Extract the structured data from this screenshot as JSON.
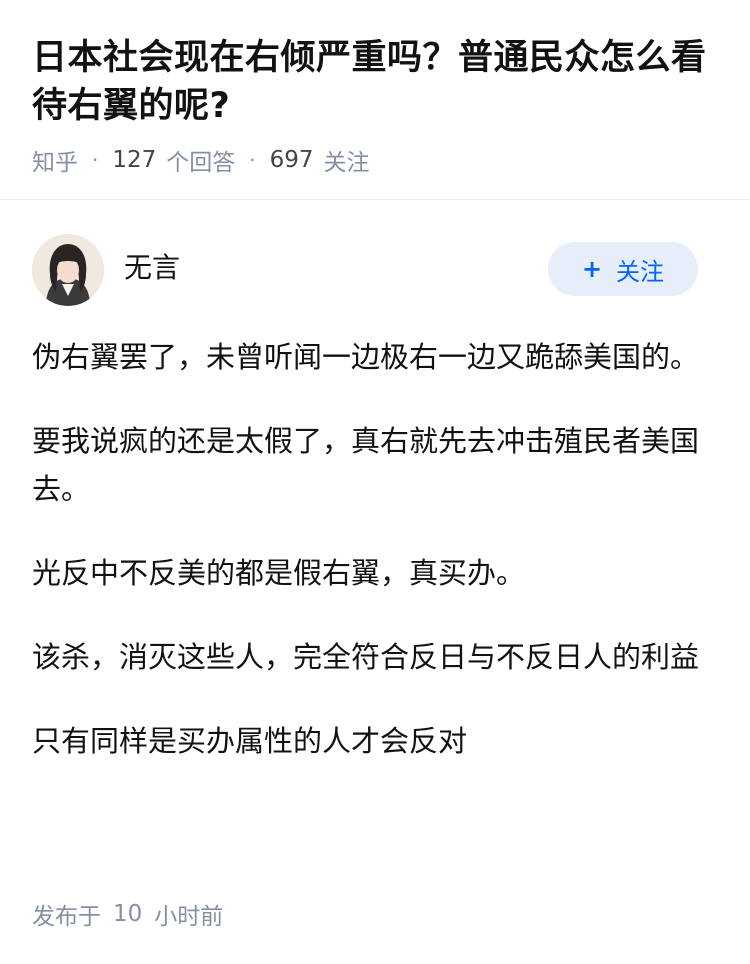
{
  "question": {
    "title": "日本社会现在右倾严重吗？普通民众怎么看待右翼的呢?",
    "meta": {
      "site": "知乎",
      "answers_count": "127",
      "answers_label": "个回答",
      "follow_count": "697",
      "follow_label": "关注"
    }
  },
  "author": {
    "name": "无言",
    "follow_button": {
      "icon": "plus-icon",
      "label": "关注",
      "color": "#0066ff",
      "background": "#e7eef9"
    }
  },
  "answer": {
    "paragraphs": [
      "伪右翼罢了，未曾听闻一边极右一边又跪舔美国的。",
      "要我说疯的还是太假了，真右就先去冲击殖民者美国去。",
      "光反中不反美的都是假右翼，真买办。",
      "该杀，消灭这些人，完全符合反日与不反日人的利益",
      "只有同样是买办属性的人才会反对"
    ],
    "footer": {
      "published_label": "发布于",
      "time_value": "10",
      "time_unit": "小时前"
    }
  },
  "colors": {
    "text": "#121212",
    "meta": "#8590a6",
    "accent": "#0066ff"
  }
}
